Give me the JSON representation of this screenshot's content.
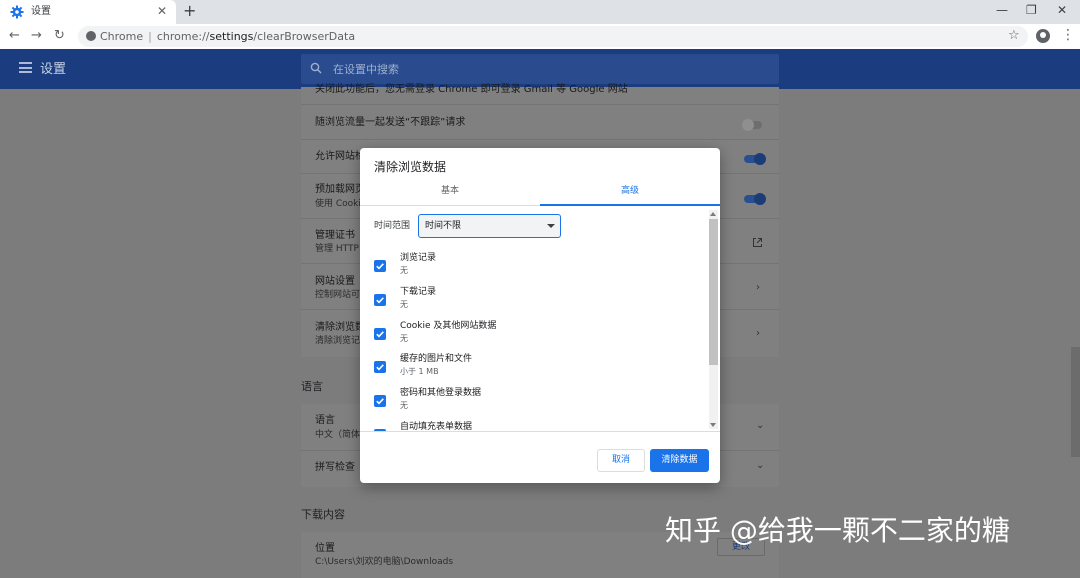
{
  "browser": {
    "tab_title": "设置",
    "tab_close": "✕",
    "new_tab": "+",
    "window_controls": [
      "—",
      "❐",
      "✕"
    ],
    "nav": {
      "back": "←",
      "forward": "→",
      "reload": "↻"
    },
    "omnibox": {
      "origin_label": "Chrome",
      "separator": "|",
      "url_scheme": "chrome://",
      "url_host": "settings",
      "url_path": "/clearBrowserData"
    },
    "bookmark": "☆",
    "menu": "⋮"
  },
  "settings": {
    "title": "设置",
    "search_placeholder": "在设置中搜索",
    "rows": [
      {
        "title": "关闭此功能后，您无需登录 Chrome 即可登录 Gmail 等 Google 网站",
        "toggle": null
      },
      {
        "title": "随浏览流量一起发送“不跟踪”请求",
        "toggle": "off"
      },
      {
        "title": "允许网站检",
        "toggle": "on"
      },
      {
        "title": "预加载网页",
        "sub": "使用 Cookie",
        "toggle": "on"
      },
      {
        "title": "管理证书",
        "sub": "管理 HTTP"
      },
      {
        "title": "网站设置",
        "sub": "控制网站可",
        "chevron": "›"
      },
      {
        "title": "清除浏览数",
        "sub": "清除浏览记",
        "chevron": "›"
      }
    ],
    "language_section": "语言",
    "language_rows": [
      {
        "title": "语言",
        "sub": "中文（简体",
        "chevron": "⌄"
      },
      {
        "title": "拼写检查",
        "chevron": "⌄"
      }
    ],
    "downloads_section": "下载内容",
    "download_location": {
      "title": "位置",
      "path": "C:\\Users\\刘欢的电脑\\Downloads",
      "change": "更改"
    }
  },
  "dialog": {
    "title": "清除浏览数据",
    "tabs": [
      "基本",
      "高级"
    ],
    "active_tab": 1,
    "time_range_label": "时间范围",
    "time_range_value": "时间不限",
    "items": [
      {
        "title": "浏览记录",
        "sub": "无",
        "checked": true
      },
      {
        "title": "下载记录",
        "sub": "无",
        "checked": true
      },
      {
        "title": "Cookie 及其他网站数据",
        "sub": "无",
        "checked": true
      },
      {
        "title": "缓存的图片和文件",
        "sub": "小于 1 MB",
        "checked": true
      },
      {
        "title": "密码和其他登录数据",
        "sub": "无",
        "checked": true
      },
      {
        "title": "自动填充表单数据",
        "sub": "",
        "checked": true
      }
    ],
    "cancel": "取消",
    "clear": "清除数据"
  },
  "watermark": "知乎 @给我一颗不二家的糖",
  "colors": {
    "accent": "#1a73e8",
    "header": "#1b3d80",
    "overlay": "#7f7f7f"
  }
}
